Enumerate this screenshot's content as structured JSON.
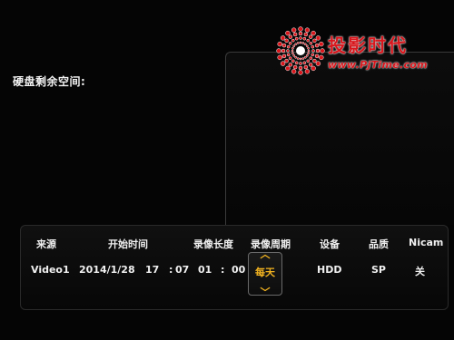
{
  "disk": {
    "free_space_label": "硬盘剩余空间:"
  },
  "watermark": {
    "brand": "投影时代",
    "url": "www.PjTime.com",
    "brand_color": "#d8161c"
  },
  "schedule": {
    "headers": {
      "source": "来源",
      "start_time": "开始时间",
      "duration": "录像长度",
      "period": "录像周期",
      "device": "设备",
      "quality": "品质",
      "nicam": "Nicam"
    },
    "row": {
      "source": "Video1",
      "date": "2014/1/28",
      "hour": "17",
      "colon1": ":",
      "minute": "07",
      "dur_hours": "01",
      "colon2": ":",
      "dur_minutes": "00",
      "period": "每天",
      "device": "HDD",
      "quality": "SP",
      "nicam": "关"
    },
    "focus_color": "#f2b320",
    "focus_up_icon": "chevron-up-icon",
    "focus_down_icon": "chevron-down-icon"
  }
}
